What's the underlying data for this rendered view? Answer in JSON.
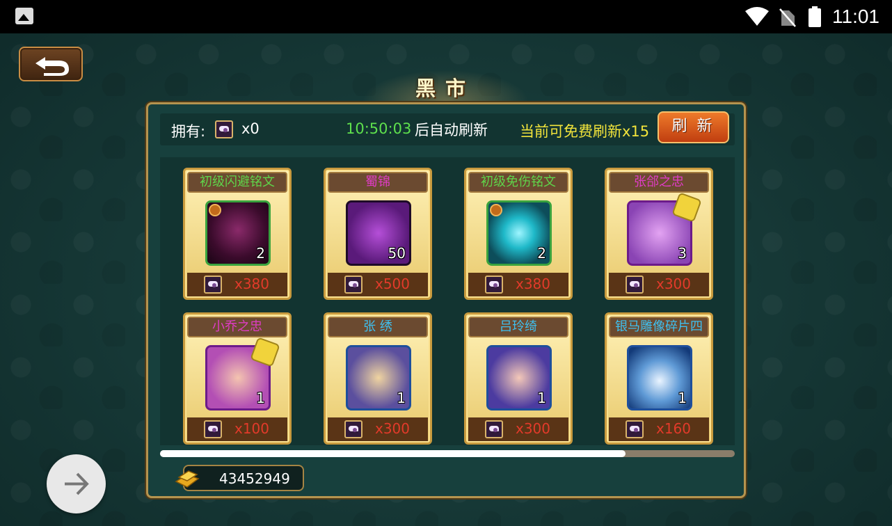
{
  "status_bar": {
    "time": "11:01"
  },
  "title": "黑市",
  "topbar": {
    "owned_label": "拥有:",
    "owned_count": "x0",
    "timer": "10:50:03",
    "auto_refresh_text": "后自动刷新",
    "free_refresh_text": "当前可免费刷新x15",
    "refresh_button": "刷新"
  },
  "items": [
    {
      "name": "初级闪避铭文",
      "name_color": "#5fd44a",
      "qty": "2",
      "price": "x380",
      "icon": "dodge-rune-icon"
    },
    {
      "name": "蜀锦",
      "name_color": "#e03cc6",
      "qty": "50",
      "price": "x500",
      "icon": "silk-icon"
    },
    {
      "name": "初级免伤铭文",
      "name_color": "#5fd44a",
      "qty": "2",
      "price": "x380",
      "icon": "damage-reduction-rune-icon"
    },
    {
      "name": "张郃之忠",
      "name_color": "#e03cc6",
      "qty": "3",
      "price": "x300",
      "icon": "zhang-he-portrait-icon"
    },
    {
      "name": "小乔之忠",
      "name_color": "#e03cc6",
      "qty": "1",
      "price": "x100",
      "icon": "xiao-qiao-portrait-icon"
    },
    {
      "name": "张 绣",
      "name_color": "#3ec0f0",
      "qty": "1",
      "price": "x300",
      "icon": "zhang-xiu-portrait-icon"
    },
    {
      "name": "吕玲绮",
      "name_color": "#3ec0f0",
      "qty": "1",
      "price": "x300",
      "icon": "lv-lingqi-portrait-icon"
    },
    {
      "name": "银马雕像碎片四",
      "name_color": "#3ec0f0",
      "qty": "1",
      "price": "x160",
      "icon": "silver-horse-shard-icon"
    }
  ],
  "scroll_progress": 0.81,
  "gold_amount": "43452949"
}
